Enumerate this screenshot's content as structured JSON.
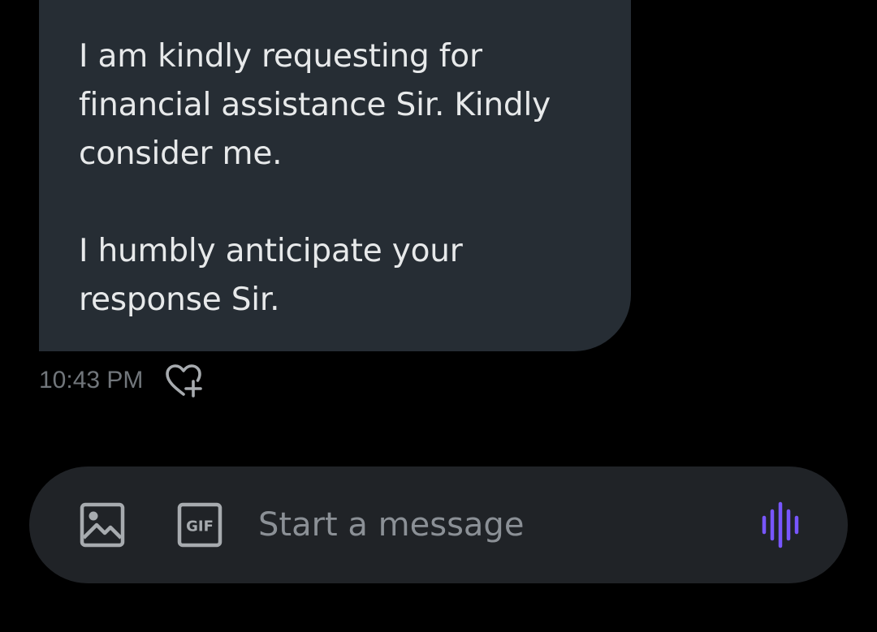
{
  "message": {
    "paragraph_1": "I am kindly requesting for financial assistance Sir. Kindly consider me.",
    "paragraph_2": "I humbly anticipate your response Sir.",
    "timestamp": "10:43 PM",
    "react_icon": "heart-plus-icon"
  },
  "composer": {
    "placeholder": "Start a message",
    "value": "",
    "image_icon": "image-icon",
    "gif_label": "GIF",
    "voice_icon": "voice-waveform-icon"
  },
  "colors": {
    "background": "#000000",
    "bubble": "#262d34",
    "composer": "#202327",
    "text": "#e7e9ea",
    "muted": "#71767b",
    "icon": "#a7abaf",
    "accent": "#7856ff"
  }
}
